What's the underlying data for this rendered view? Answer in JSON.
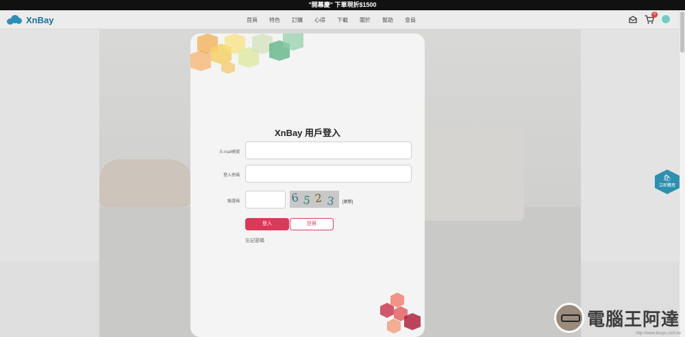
{
  "promo": {
    "text": "\"開幕慶\" 下單現折$1500"
  },
  "navbar": {
    "logo_text": "XnBay",
    "links": [
      "首頁",
      "特色",
      "訂購",
      "心得",
      "下載",
      "關於",
      "幫助",
      "會員"
    ],
    "cart_count": "0"
  },
  "side_button": {
    "label": "立即購買"
  },
  "login": {
    "title": "XnBay 用戶登入",
    "email_label": "E-mail帳號",
    "password_label": "登入密碼",
    "captcha_label": "驗證碼",
    "captcha_chars": [
      "6",
      "5",
      "2",
      "3"
    ],
    "refresh_label": "[更新]",
    "login_button": "登入",
    "register_button": "註冊",
    "forgot_link": "忘記密碼"
  },
  "watermark": {
    "text": "電腦王阿達",
    "url": "http://www.kocpc.com.tw"
  },
  "colors": {
    "accent": "#d93a5a",
    "brand": "#2d8fb8",
    "promo_bg": "#111111"
  }
}
